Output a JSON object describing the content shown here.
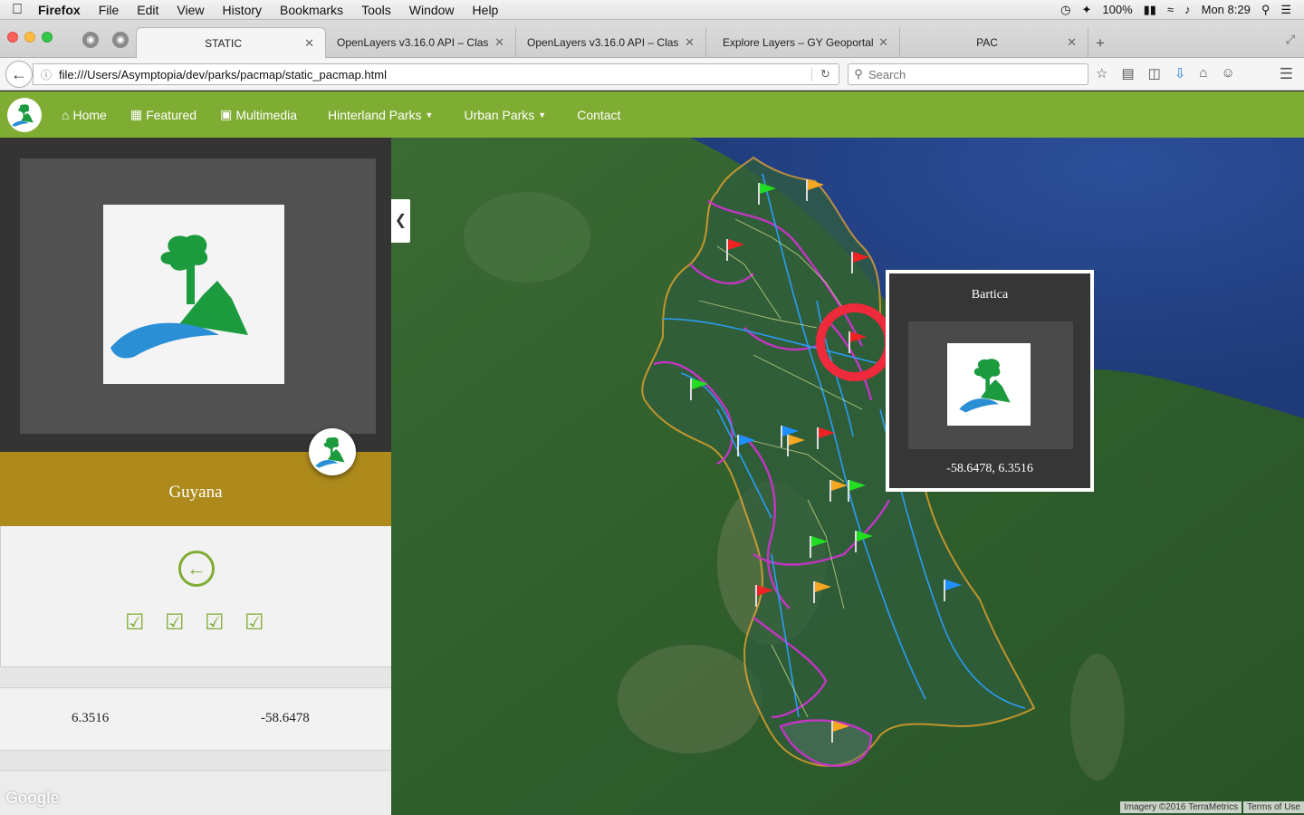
{
  "menubar": {
    "app": "Firefox",
    "items": [
      "File",
      "Edit",
      "View",
      "History",
      "Bookmarks",
      "Tools",
      "Window",
      "Help"
    ],
    "battery": "100%",
    "clock": "Mon 8:29"
  },
  "tabs": [
    {
      "title": "STATIC",
      "active": true
    },
    {
      "title": "OpenLayers v3.16.0 API – Clas…",
      "active": false
    },
    {
      "title": "OpenLayers v3.16.0 API – Clas…",
      "active": false
    },
    {
      "title": "Explore Layers – GY Geoportal",
      "active": false
    },
    {
      "title": "PAC",
      "active": false
    }
  ],
  "navbar": {
    "url": "file:///Users/Asymptopia/dev/parks/pacmap/static_pacmap.html",
    "search_placeholder": "Search"
  },
  "site": {
    "menu": [
      {
        "label": "Home",
        "icon": "home-icon",
        "dropdown": false
      },
      {
        "label": "Featured",
        "icon": "film-icon",
        "dropdown": false
      },
      {
        "label": "Multimedia",
        "icon": "image-icon",
        "dropdown": false
      },
      {
        "label": "Hinterland Parks",
        "icon": "",
        "dropdown": true
      },
      {
        "label": "Urban Parks",
        "icon": "",
        "dropdown": true
      },
      {
        "label": "Contact",
        "icon": "",
        "dropdown": false
      }
    ]
  },
  "sidebar": {
    "place_name": "Guyana",
    "lat": "6.3516",
    "lon": "-58.6478",
    "layer_toggles": 4,
    "google_mark": "Google"
  },
  "map": {
    "popup": {
      "title": "Bartica",
      "coords": "-58.6478, 6.3516"
    },
    "attribution": {
      "imagery": "Imagery ©2016 TerraMetrics",
      "terms": "Terms of Use"
    },
    "colors": {
      "district_border": "#cc33cc",
      "river": "#2a9df4",
      "road": "#e8f29a",
      "national_border": "#f0a830",
      "flag_green": "#22dd22",
      "flag_red": "#ee2222",
      "flag_orange": "#f5a623",
      "flag_blue": "#1e90ff"
    }
  }
}
